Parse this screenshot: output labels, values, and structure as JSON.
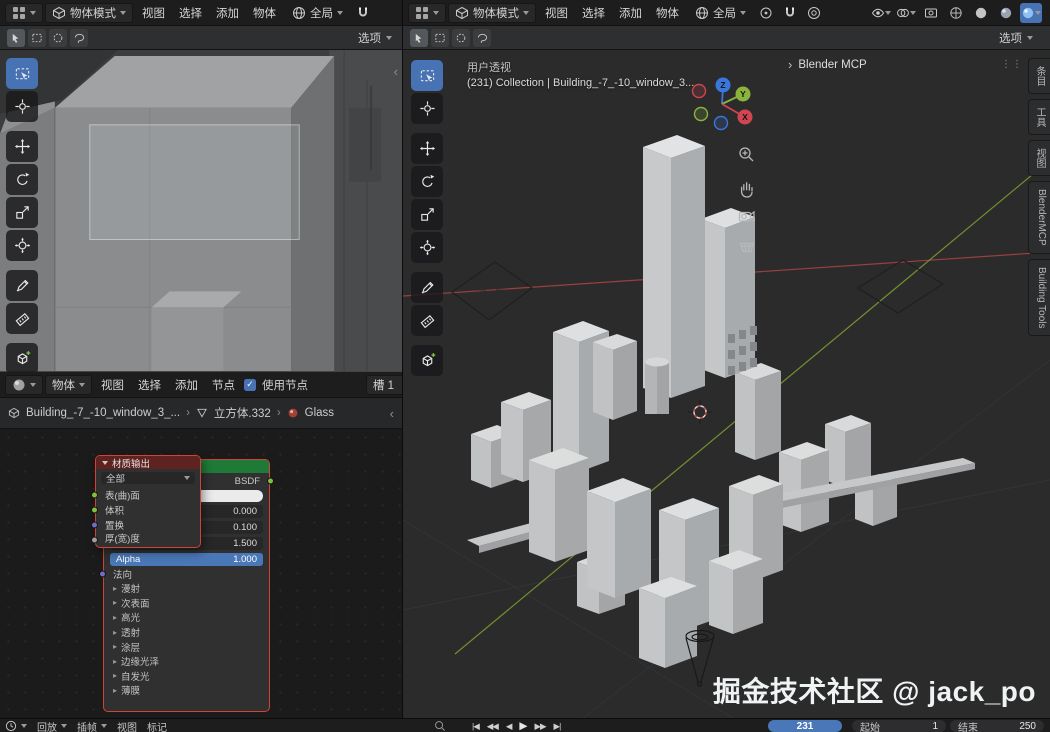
{
  "colors": {
    "accent_blue": "#4772b3",
    "selected_node_outline": "#cf4436",
    "bsdf_header_green": "#1f7a38",
    "output_header_red": "#5e2320",
    "axis_x_red": "#d04550",
    "axis_y_green": "#8bb43a",
    "axis_z_blue": "#3a77dd"
  },
  "left_window": {
    "menubar": {
      "mode": "物体模式",
      "menus": [
        "视图",
        "选择",
        "添加",
        "物体"
      ],
      "orientation": "全局"
    },
    "tool_header": {
      "options": "选项"
    },
    "toolbar_tools": [
      "box-select",
      "cursor",
      "move",
      "rotate",
      "scale",
      "transform",
      "annotate",
      "measure",
      "add-cube"
    ],
    "shader_editor": {
      "header": {
        "type": "物体",
        "menus": [
          "视图",
          "选择",
          "添加",
          "节点"
        ],
        "use_nodes": "使用节点",
        "slot": "槽 1"
      },
      "breadcrumb": {
        "items": [
          "Building_-7_-10_window_3_...",
          "立方体.332",
          "Glass"
        ],
        "separator": "›"
      },
      "material_output": {
        "title": "材质输出",
        "target": "全部",
        "inputs": [
          "表(曲)面",
          "体积",
          "置换",
          "厚(宽)度"
        ]
      },
      "bsdf": {
        "output_label": "BSDF",
        "values": [
          "0.000",
          "0.100",
          "1.500"
        ],
        "alpha_label": "Alpha",
        "alpha_value": "1.000",
        "normal_label": "法向",
        "sections": [
          "漫射",
          "次表面",
          "高光",
          "透射",
          "涂层",
          "边缘光泽",
          "自发光",
          "薄膜"
        ]
      }
    }
  },
  "right_window": {
    "menubar": {
      "mode": "物体模式",
      "menus": [
        "视图",
        "选择",
        "添加",
        "物体"
      ],
      "orientation": "全局"
    },
    "tool_header": {
      "options": "选项"
    },
    "toolbar_tools": [
      "box-select",
      "cursor",
      "move",
      "rotate",
      "scale",
      "transform",
      "annotate",
      "measure",
      "add-cube"
    ],
    "viewport": {
      "view_name": "用户透视",
      "collection_info": "(231) Collection | Building_-7_-10_window_3...",
      "panel_title": "Blender MCP",
      "axis_labels": {
        "x": "X",
        "y": "Y",
        "z": "Z"
      }
    },
    "sidebar_tabs": [
      "条目",
      "工具",
      "视图",
      "BlenderMCP",
      "Building Tools"
    ],
    "watermark": "掘金技术社区 @ jack_po"
  },
  "timeline": {
    "menus": [
      "回放",
      "插帧",
      "视图",
      "标记"
    ],
    "transport": [
      "jump-to-start",
      "prev-keyframe",
      "play-reverse",
      "play",
      "next-keyframe",
      "jump-to-end"
    ],
    "current_frame": "231",
    "start_label": "起始",
    "start_value": "1",
    "end_label": "结束",
    "end_value": "250"
  }
}
